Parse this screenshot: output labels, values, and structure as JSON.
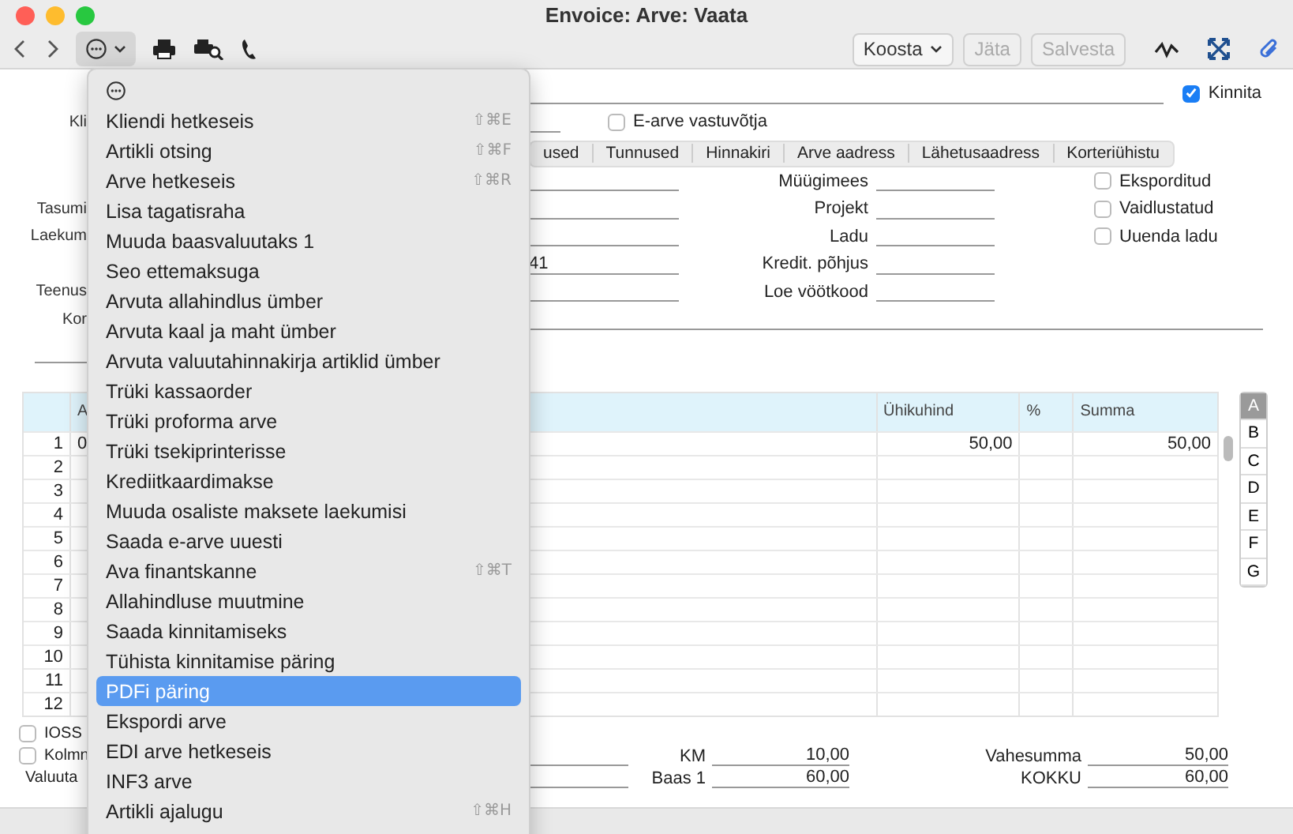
{
  "window": {
    "title": "Envoice: Arve: Vaata"
  },
  "toolbar": {
    "actions_button": {
      "pressed": true
    },
    "right_buttons": [
      {
        "label": "Koosta",
        "disabled": false,
        "dropdown": true
      },
      {
        "label": "Jäta",
        "disabled": true,
        "dropdown": false
      },
      {
        "label": "Salvesta",
        "disabled": true,
        "dropdown": false
      }
    ]
  },
  "form": {
    "top_checkbox": {
      "label": "Kinnita",
      "checked": true
    },
    "customer_row": {
      "label": "Kli",
      "checkbox": {
        "label": "E-arve vastuvõtja",
        "checked": false
      }
    },
    "tabs": [
      {
        "label": "used",
        "selected": false
      },
      {
        "label": "Tunnused",
        "selected": false
      },
      {
        "label": "Hinnakiri",
        "selected": false
      },
      {
        "label": "Arve aadress",
        "selected": false
      },
      {
        "label": "Lähetusaadress",
        "selected": false
      },
      {
        "label": "Korteriühistu",
        "selected": false
      }
    ],
    "rows": [
      {
        "mid_label": "Müügimees",
        "checkbox": {
          "label": "Eksporditud",
          "checked": false
        }
      },
      {
        "left_label": "Tasumi",
        "mid_label": "Projekt",
        "checkbox": {
          "label": "Vaidlustatud",
          "checked": false
        }
      },
      {
        "left_label": "Laekum",
        "mid_label": "Ladu",
        "checkbox": {
          "label": "Uuenda ladu",
          "checked": false
        }
      },
      {
        "left_value": "41",
        "mid_label": "Kredit. põhjus"
      },
      {
        "left_label": "Teenus",
        "mid_label": "Loe vöötkood"
      }
    ],
    "comment_label": "Kor"
  },
  "table": {
    "columns": [
      {
        "label": "A"
      },
      {
        "label": "Ühikuhind"
      },
      {
        "label": "%"
      },
      {
        "label": "Summa"
      }
    ],
    "rows": [
      {
        "number": "1",
        "column_a": "0",
        "unit_price": "50,00",
        "sum": "50,00"
      },
      {
        "number": "2"
      },
      {
        "number": "3"
      },
      {
        "number": "4"
      },
      {
        "number": "5"
      },
      {
        "number": "6"
      },
      {
        "number": "7"
      },
      {
        "number": "8"
      },
      {
        "number": "9"
      },
      {
        "number": "10"
      },
      {
        "number": "11"
      },
      {
        "number": "12"
      }
    ],
    "side_tabs": [
      {
        "label": "A",
        "selected": true
      },
      {
        "label": "B",
        "selected": false
      },
      {
        "label": "C",
        "selected": false
      },
      {
        "label": "D",
        "selected": false
      },
      {
        "label": "E",
        "selected": false
      },
      {
        "label": "F",
        "selected": false
      },
      {
        "label": "G",
        "selected": false
      }
    ]
  },
  "footer": {
    "checkboxes": [
      {
        "label": "IOSS",
        "checked": false
      },
      {
        "label": "Kolmn",
        "checked": false
      }
    ],
    "currency_label": "Valuuta",
    "totals": [
      {
        "label": "KM",
        "value": "10,00"
      },
      {
        "label": "Vahesumma",
        "value": "50,00"
      },
      {
        "label": "Baas 1",
        "value": "60,00"
      },
      {
        "label": "KOKKU",
        "value": "60,00"
      }
    ]
  },
  "menu": {
    "items": [
      {
        "label": "Kliendi hetkeseis",
        "shortcut": "⇧⌘E",
        "selected": false
      },
      {
        "label": "Artikli otsing",
        "shortcut": "⇧⌘F",
        "selected": false
      },
      {
        "label": "Arve hetkeseis",
        "shortcut": "⇧⌘R",
        "selected": false
      },
      {
        "label": "Lisa tagatisraha",
        "selected": false
      },
      {
        "label": "Muuda baasvaluutaks 1",
        "selected": false
      },
      {
        "label": "Seo ettemaksuga",
        "selected": false
      },
      {
        "label": "Arvuta allahindlus ümber",
        "selected": false
      },
      {
        "label": "Arvuta kaal ja maht ümber",
        "selected": false
      },
      {
        "label": "Arvuta valuutahinnakirja artiklid ümber",
        "selected": false
      },
      {
        "label": "Trüki kassaorder",
        "selected": false
      },
      {
        "label": "Trüki proforma arve",
        "selected": false
      },
      {
        "label": "Trüki tsekiprinterisse",
        "selected": false
      },
      {
        "label": "Krediitkaardimakse",
        "selected": false
      },
      {
        "label": "Muuda osaliste maksete laekumisi",
        "selected": false
      },
      {
        "label": "Saada e-arve uuesti",
        "selected": false
      },
      {
        "label": "Ava finantskanne",
        "shortcut": "⇧⌘T",
        "selected": false
      },
      {
        "label": "Allahindluse muutmine",
        "selected": false
      },
      {
        "label": "Saada kinnitamiseks",
        "selected": false
      },
      {
        "label": "Tühista kinnitamise päring",
        "selected": false
      },
      {
        "label": "PDFi päring",
        "selected": true
      },
      {
        "label": "Ekspordi arve",
        "selected": false
      },
      {
        "label": "EDI arve hetkeseis",
        "selected": false
      },
      {
        "label": "INF3 arve",
        "selected": false
      },
      {
        "label": "Artikli ajalugu",
        "shortcut": "⇧⌘H",
        "selected": false
      }
    ]
  }
}
